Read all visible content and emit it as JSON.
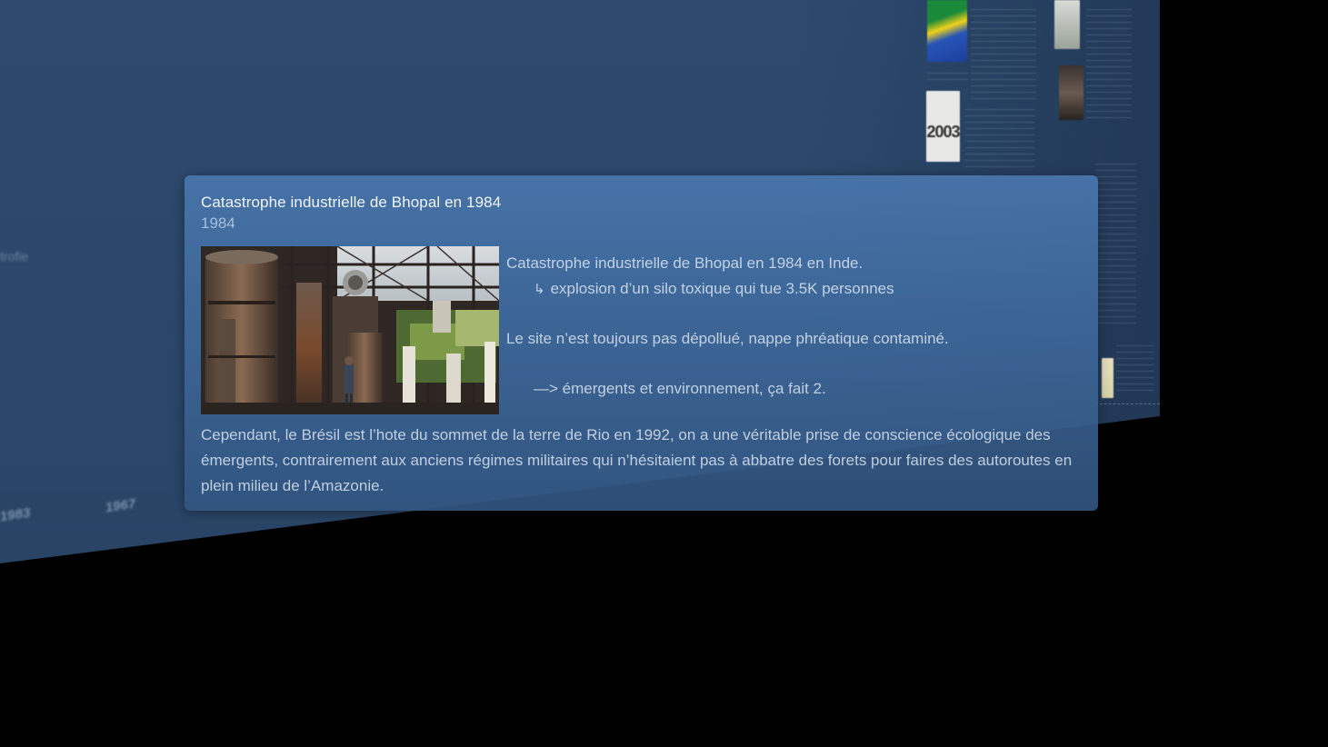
{
  "background": {
    "year_labels": [
      "1967",
      "1983"
    ],
    "left_fragment": "trofie",
    "thumb_year": "2003"
  },
  "popup": {
    "title": "Catastrophe industrielle de Bhopal en 1984",
    "year": "1984",
    "image_alt": "Rusted industrial plant ruins at Bhopal",
    "description": {
      "line1": "Catastrophe industrielle de Bhopal en 1984 en Inde.",
      "line2_arrow": "↳",
      "line2": "explosion d’un silo toxique qui tue 3.5K personnes",
      "line3": "Le site n’est toujours pas dépollué, nappe phréatique contaminé.",
      "line4": "—> émergents et environnement, ça fait 2."
    },
    "paragraph": "Cependant, le Brésil est l’hote du sommet de la terre de Rio en 1992, on a une véritable prise de conscience écologique des émergents, contrairement aux anciens régimes militaires qui n’hésitaient pas à abbatre des forets pour faires des autoroutes en plein milieu de l’Amazonie."
  },
  "colors": {
    "plane": "#2d4a6e",
    "popup": "#4876ac",
    "text": "#dee8f4"
  }
}
